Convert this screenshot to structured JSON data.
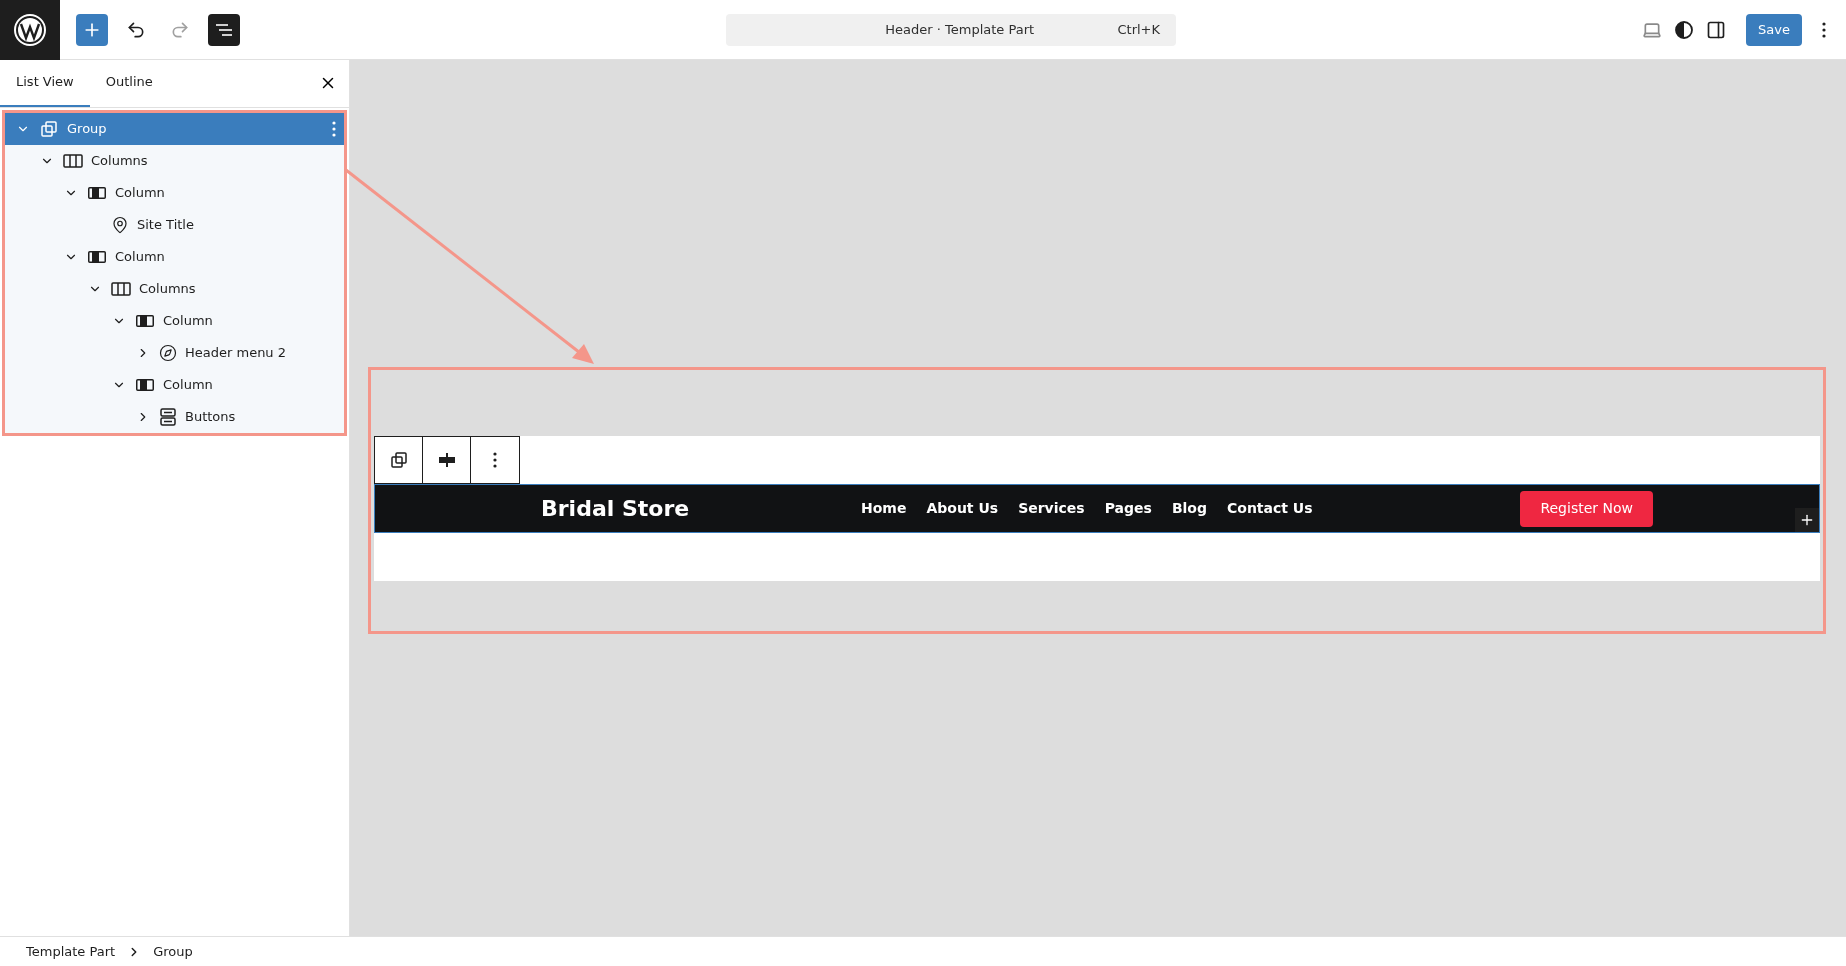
{
  "toolbar": {
    "document_title": "Header · Template Part",
    "shortcut": "Ctrl+K",
    "save_label": "Save",
    "redo_disabled": true
  },
  "sidebar": {
    "tabs": [
      {
        "label": "List View",
        "selected": true
      },
      {
        "label": "Outline",
        "selected": false
      }
    ],
    "tree": [
      {
        "label": "Group",
        "kind": "group",
        "selected": true,
        "expanded": true,
        "children": [
          {
            "label": "Columns",
            "kind": "columns",
            "selected": false,
            "expanded": true,
            "children": [
              {
                "label": "Column",
                "kind": "column",
                "selected": false,
                "expanded": true,
                "children": [
                  {
                    "label": "Site Title",
                    "kind": "site-title",
                    "selected": false
                  }
                ]
              },
              {
                "label": "Column",
                "kind": "column",
                "selected": false,
                "expanded": true,
                "children": [
                  {
                    "label": "Columns",
                    "kind": "columns",
                    "selected": false,
                    "expanded": true,
                    "children": [
                      {
                        "label": "Column",
                        "kind": "column",
                        "selected": false,
                        "expanded": true,
                        "children": [
                          {
                            "label": "Header menu 2",
                            "kind": "navigation",
                            "selected": false,
                            "expanded": false
                          }
                        ]
                      },
                      {
                        "label": "Column",
                        "kind": "column",
                        "selected": false,
                        "expanded": true,
                        "children": [
                          {
                            "label": "Buttons",
                            "kind": "buttons",
                            "selected": false,
                            "expanded": false
                          }
                        ]
                      }
                    ]
                  }
                ]
              }
            ]
          }
        ]
      }
    ]
  },
  "canvas": {
    "site_title": "Bridal Store",
    "menu": [
      "Home",
      "About Us",
      "Services",
      "Pages",
      "Blog",
      "Contact Us"
    ],
    "cta": "Register Now"
  },
  "breadcrumb": [
    "Template Part",
    "Group"
  ]
}
